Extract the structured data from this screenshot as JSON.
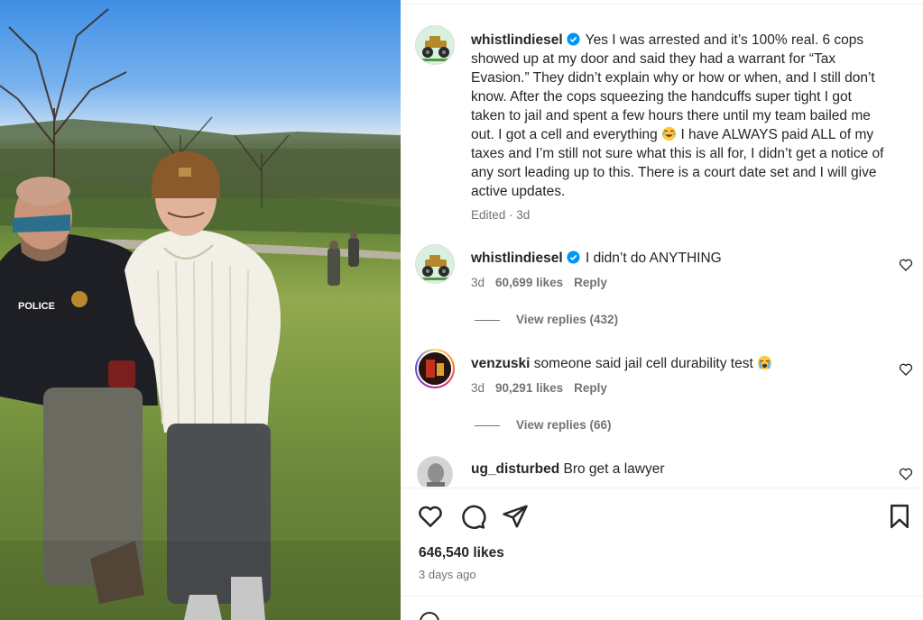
{
  "post": {
    "author": "whistlindiesel",
    "caption": "Yes I was arrested and it’s 100% real. 6 cops showed up at my door and said they had a warrant for “Tax Evasion.” They didn’t explain why or how or when, and I still don’t know. After the cops squeezing the handcuffs super tight I got taken to jail and spent a few hours there until my team bailed me out. I got a cell and everything",
    "caption_line1_rest": "Yes I was arrested and it’s 100% real. 6 cops",
    "caption_line2": "showed up at my door and said they had a warrant for “Tax",
    "caption_line3": "Evasion.” They didn’t explain why or how or when, and I still don’t",
    "caption_line4": "know. After the cops squeezing the handcuffs super tight I got",
    "caption_line5": "taken to jail and spent a few hours there until my team bailed me",
    "caption_line6_a": "out. I got a cell and everything",
    "caption_line6_b": "I have ALWAYS paid ALL of my",
    "caption_line7": "taxes and I’m still not sure what this is all for, I didn’t get a notice of",
    "caption_line8": "any sort leading up to this. There is a court date set and I will give",
    "caption_line9": "active updates.",
    "edited_label": "Edited · 3d",
    "likes": "646,540 likes",
    "time_ago": "3 days ago"
  },
  "comments": [
    {
      "user": "whistlindiesel",
      "text": "I didn’t do ANYTHING",
      "age": "3d",
      "likes": "60,699 likes",
      "reply_label": "Reply",
      "view_replies": "View replies (432)"
    },
    {
      "user": "venzuski",
      "text": "someone said jail cell durability test",
      "age": "3d",
      "likes": "90,291 likes",
      "reply_label": "Reply",
      "view_replies": "View replies (66)"
    },
    {
      "user": "ug_disturbed",
      "text": "Bro get a lawyer"
    }
  ],
  "photo": {
    "badge_text": "POLICE"
  },
  "icons": {
    "like": "heart-icon",
    "comment": "comment-icon",
    "share": "share-icon",
    "save": "bookmark-icon",
    "verified": "verified-badge-icon",
    "laugh_emoji": "laughing-emoji-icon",
    "cry_emoji": "crying-emoji-icon"
  },
  "colors": {
    "verified": "#0095f6",
    "text": "#262626",
    "secondary": "#737373"
  }
}
